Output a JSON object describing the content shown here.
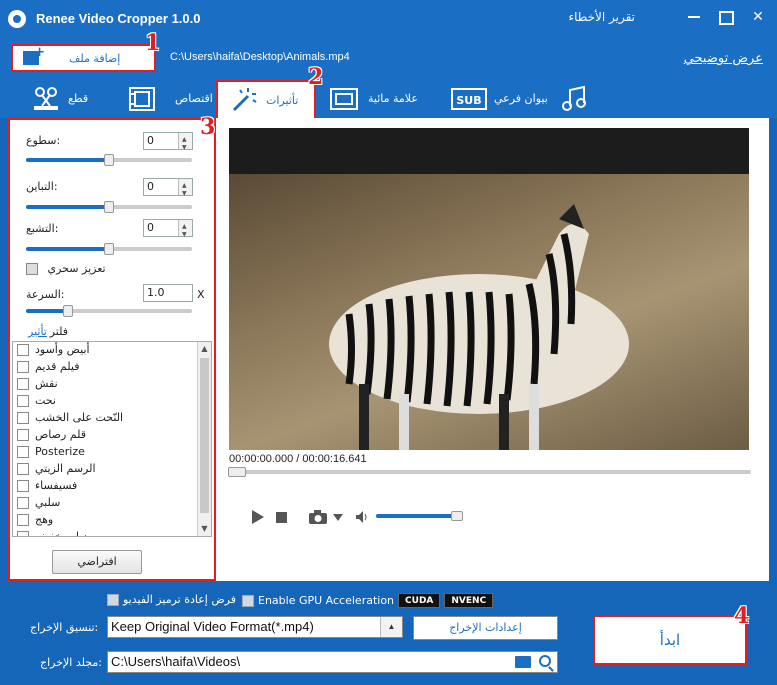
{
  "window": {
    "title": "Renee Video Cropper 1.0.0",
    "debug_label": "تقرير الأخطاء"
  },
  "toolbar": {
    "add_file_label": "إضافة ملف",
    "file_path": "C:\\Users\\haifa\\Desktop\\Animals.mp4",
    "demo_link": "عرض توضيحي"
  },
  "badges": [
    "1",
    "2",
    "3",
    "4"
  ],
  "tabs": [
    {
      "label": "قطع",
      "icon": "cut-icon"
    },
    {
      "label": "اقتصاص",
      "icon": "crop-icon"
    },
    {
      "label": "تأثيرات",
      "icon": "magic-wand-icon",
      "active": true
    },
    {
      "label": "علامة مائية",
      "icon": "watermark-icon"
    },
    {
      "label": "بيوان فرعي",
      "icon": "subtitle-icon"
    },
    {
      "label": "",
      "icon": "music-icon"
    }
  ],
  "effects": {
    "brightness_label": "سطوع:",
    "brightness_value": "0",
    "brightness_level": 0.5,
    "contrast_label": "التباين:",
    "contrast_value": "0",
    "contrast_level": 0.5,
    "saturation_label": "التشبع:",
    "saturation_value": "0",
    "saturation_level": 0.5,
    "magic_enhance_label": "تعزيز سحري",
    "speed_label": "السرعة:",
    "speed_value": "1.0",
    "speed_unit": "X",
    "speed_level": 0.25,
    "filter_label": "فلتر",
    "filter_effect_link": "تأثير",
    "filters": [
      "أبيض وأسود",
      "فيلم قديم",
      "نقش",
      "نحت",
      "النّحت على الخشب",
      "قلم رصاص",
      "Posterize",
      "الرسم الزيتي",
      "فسيفساء",
      "سلبي",
      "وهج",
      "ضباب خفيف"
    ],
    "default_button": "افتراضي"
  },
  "player": {
    "time": "00:00:00.000 / 00:00:16.641",
    "progress": 0.0,
    "volume": 1.0
  },
  "bottom": {
    "reencode_label": "فرض إعادة ترميز الفيديو",
    "gpu_label": "Enable GPU Acceleration",
    "cuda_label": "CUDA",
    "nvenc_label": "NVENC",
    "format_label": "تنسيق الإخراج:",
    "format_value": "Keep Original Video Format(*.mp4)",
    "output_settings": "إعدادات الإخراج",
    "folder_label": "مجلد الإخراج:",
    "folder_value": "C:\\Users\\haifa\\Videos\\",
    "start_button": "ابدأ"
  },
  "colors": {
    "accent": "#1a6fc4",
    "highlight": "#e02020"
  }
}
